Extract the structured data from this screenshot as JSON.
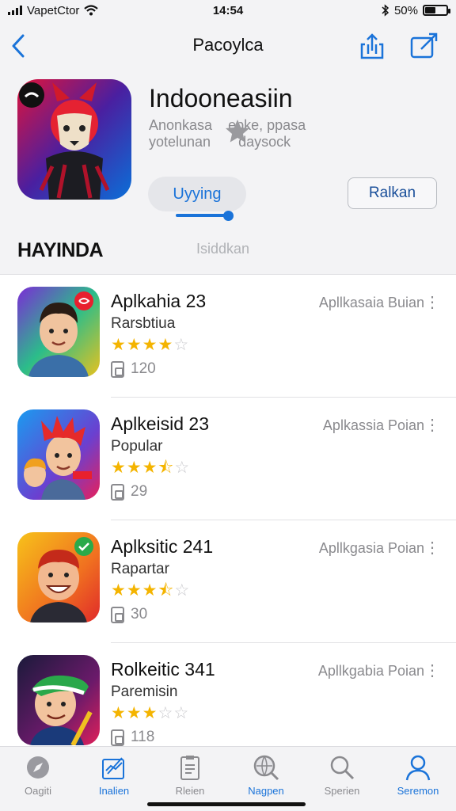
{
  "status_bar": {
    "carrier": "VapetCtor",
    "time": "14:54",
    "battery_text": "50%",
    "battery_level": 0.5,
    "icons": [
      "signal-icon",
      "wifi-icon",
      "bluetooth-icon",
      "battery-icon"
    ]
  },
  "nav": {
    "title": "Pacoylca",
    "back_icon": "chevron-left-icon",
    "share_icon": "share-icon",
    "edit_icon": "edit-icon"
  },
  "app": {
    "name": "Indooneasiin",
    "subtitle_line1": "Anonkasa    epke, ppasa",
    "subtitle_line2": "yotelunan       daysock",
    "primary_button": "Uyying",
    "secondary_button": "Ralkan",
    "progress": 0.9
  },
  "section": {
    "title": "HAYINDA",
    "subtitle": "Isiddkan"
  },
  "list": [
    {
      "title": "Aplkahia 23",
      "category": "Rarsbtiua",
      "rating": 4,
      "count": "120",
      "right": "Apllkasaia Buian"
    },
    {
      "title": "Aplkeisid 23",
      "category": "Popular",
      "rating": 3.5,
      "count": "29",
      "right": "Aplkassia Poian"
    },
    {
      "title": "Aplksitic 241",
      "category": "Rapartar",
      "rating": 3.5,
      "count": "30",
      "right": "Apllkgasia Poian"
    },
    {
      "title": "Rolkeitic 341",
      "category": "Paremisin",
      "rating": 3,
      "count": "118",
      "right": "Apllkgabia Poian"
    }
  ],
  "tabs": [
    {
      "label": "Oagiti",
      "icon": "compass-icon",
      "active": false
    },
    {
      "label": "Inalien",
      "icon": "edit-square-icon",
      "active": true
    },
    {
      "label": "Rleien",
      "icon": "document-icon",
      "active": false
    },
    {
      "label": "Nagpen",
      "icon": "magnifier-globe-icon",
      "active": true
    },
    {
      "label": "Sperien",
      "icon": "search-icon",
      "active": false
    },
    {
      "label": "Seremon",
      "icon": "person-icon",
      "active": true
    }
  ],
  "colors": {
    "accent": "#1a73d9",
    "star": "#f4b400",
    "background": "#f3f3f5"
  }
}
